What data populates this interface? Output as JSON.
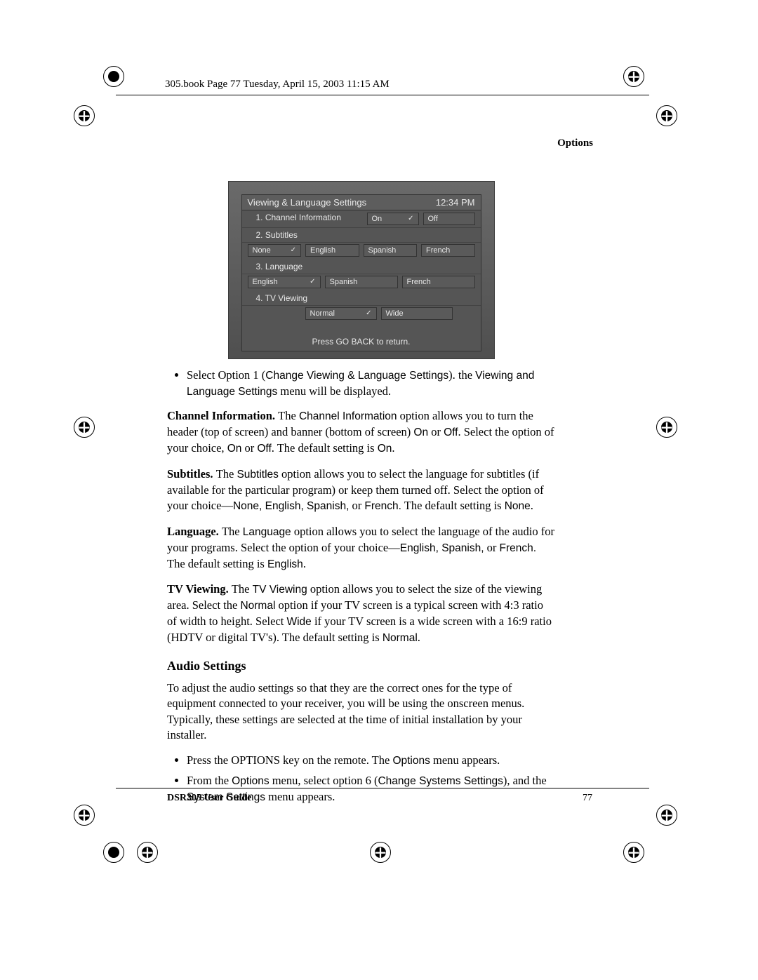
{
  "header": {
    "book_stamp": "305.book  Page 77  Tuesday, April 15, 2003  11:15 AM",
    "section": "Options"
  },
  "screenshot": {
    "title": "Viewing & Language Settings",
    "time": "12:34 PM",
    "row1": {
      "label": "1.  Channel Information",
      "options": [
        "On",
        "Off"
      ],
      "selected": 0
    },
    "row2": {
      "label": "2.  Subtitles",
      "options": [
        "None",
        "English",
        "Spanish",
        "French"
      ],
      "selected": 0
    },
    "row3": {
      "label": "3.  Language",
      "options": [
        "English",
        "Spanish",
        "French"
      ],
      "selected": 0
    },
    "row4": {
      "label": "4.  TV Viewing",
      "options": [
        "Normal",
        "Wide"
      ],
      "selected": 0
    },
    "footer": "Press GO BACK to return."
  },
  "bullets_top": [
    {
      "pre": "Select Option 1 (",
      "ui1": "Change Viewing & Language Settings",
      "mid": "). the ",
      "ui2": "Viewing and Language Settings",
      "post": " menu will be displayed."
    }
  ],
  "paragraphs": {
    "channel": {
      "term": "Channel Information. ",
      "t1": "The ",
      "ui1": "Channel Information",
      "t2": " option allows you to turn the header (top of screen) and banner (bottom of screen) ",
      "ui2": "On",
      "t3": " or ",
      "ui3": "Off",
      "t4": ". Select the option of your choice, ",
      "ui4": "On",
      "t5": " or ",
      "ui5": "Off",
      "t6": ". The default setting is ",
      "ui6": "On",
      "t7": "."
    },
    "subtitles": {
      "term": "Subtitles. ",
      "t1": "The ",
      "ui1": "Subtitles",
      "t2": " option allows you to select the language for subtitles (if available for the particular program) or keep them turned off. Select the option of your choice—",
      "ui2": "None, English, Spanish,",
      "t3": " or ",
      "ui3": "French.",
      "t4": " The default setting is ",
      "ui4": "None",
      "t5": "."
    },
    "language": {
      "term": "Language. ",
      "t1": "The ",
      "ui1": "Language",
      "t2": " option allows you to select the language of the audio for your programs. Select the option of your choice—",
      "ui2": "English, Spanish,",
      "t3": " or ",
      "ui3": "French.",
      "t4": " The default setting is ",
      "ui4": "English",
      "t5": "."
    },
    "tvviewing": {
      "term": "TV Viewing. ",
      "t1": "The ",
      "ui1": "TV Viewing",
      "t2": " option allows you to select the size of the viewing area. Select the ",
      "ui2": "Normal",
      "t3": " option if your TV screen is a typical screen with 4:3 ratio of width to height. Select ",
      "ui3": "Wide",
      "t4": " if your TV screen is a wide screen with a 16:9 ratio (HDTV or digital TV's). The default setting is ",
      "ui4": "Normal",
      "t5": "."
    }
  },
  "audio": {
    "heading": "Audio Settings",
    "intro": "To adjust the audio settings so that they are the correct ones for the type of equipment connected to your receiver, you will be using the onscreen menus. Typically, these settings are selected at the time of initial installation by your installer.",
    "b1": {
      "t1": "Press the OPTIONS key on the remote. The ",
      "ui1": "Options",
      "t2": " menu appears."
    },
    "b2": {
      "t1": "From the ",
      "ui1": "Options",
      "t2": " menu, select option 6 (",
      "ui2": "Change Systems Settings",
      "t3": "), and the ",
      "ui3": "System Settings",
      "t4": " menu appears."
    }
  },
  "footer": {
    "guide": "DSR305 User Guide",
    "page": "77"
  }
}
